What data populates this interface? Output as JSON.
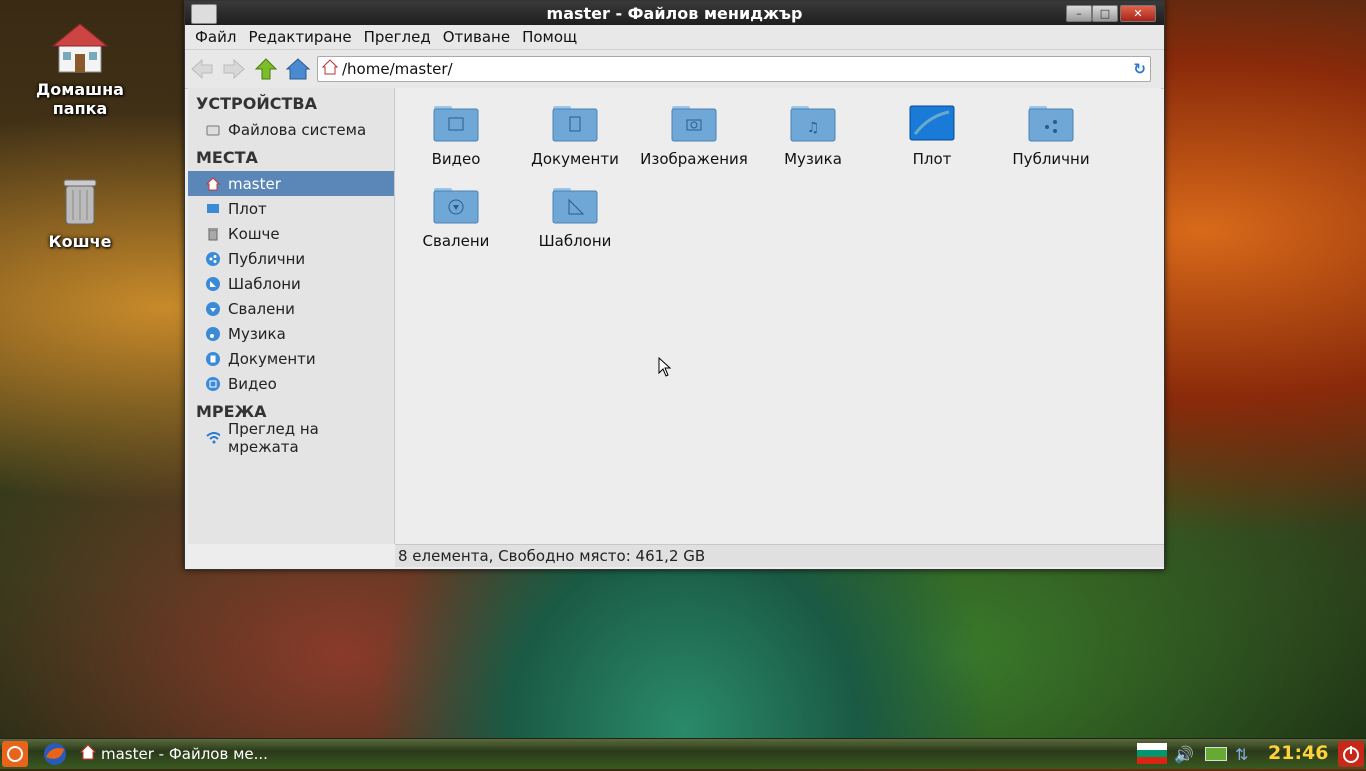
{
  "desktop": {
    "icons": [
      {
        "label_line1": "Домашна",
        "label_line2": "папка",
        "icon": "home-folder-icon"
      },
      {
        "label": "Кошче",
        "icon": "trash-icon"
      }
    ]
  },
  "window": {
    "title": "master - Файлов мениджър",
    "menu": [
      "Файл",
      "Редактиране",
      "Преглед",
      "Отиване",
      "Помощ"
    ],
    "location": "/home/master/",
    "sidebar": {
      "devices_heading": "УСТРОЙСТВА",
      "devices": [
        {
          "label": "Файлова система",
          "icon": "drive-icon"
        }
      ],
      "places_heading": "МЕСТА",
      "places": [
        {
          "label": "master",
          "icon": "home-icon",
          "selected": true
        },
        {
          "label": "Плот",
          "icon": "desktop-icon"
        },
        {
          "label": "Кошче",
          "icon": "trash-icon"
        },
        {
          "label": "Публични",
          "icon": "share-icon"
        },
        {
          "label": "Шаблони",
          "icon": "templates-icon"
        },
        {
          "label": "Свалени",
          "icon": "download-icon"
        },
        {
          "label": "Музика",
          "icon": "music-icon"
        },
        {
          "label": "Документи",
          "icon": "documents-icon"
        },
        {
          "label": "Видео",
          "icon": "video-icon"
        }
      ],
      "network_heading": "МРЕЖА",
      "network": [
        {
          "label": "Преглед на мрежата",
          "icon": "wifi-icon"
        }
      ]
    },
    "files": [
      {
        "label": "Видео",
        "icon": "video-folder-icon"
      },
      {
        "label": "Документи",
        "icon": "documents-folder-icon"
      },
      {
        "label": "Изображения",
        "icon": "pictures-folder-icon"
      },
      {
        "label": "Музика",
        "icon": "music-folder-icon"
      },
      {
        "label": "Плот",
        "icon": "desktop-folder-icon"
      },
      {
        "label": "Публични",
        "icon": "public-folder-icon"
      },
      {
        "label": "Свалени",
        "icon": "downloads-folder-icon"
      },
      {
        "label": "Шаблони",
        "icon": "templates-folder-icon"
      }
    ],
    "status": "8 елемента, Свободно място: 461,2 GB"
  },
  "taskbar": {
    "task_label": "master - Файлов ме...",
    "clock": "21:46"
  },
  "colors": {
    "selection": "#5a86b8",
    "folder": "#6fa8d6",
    "clock": "#ffd23a"
  }
}
